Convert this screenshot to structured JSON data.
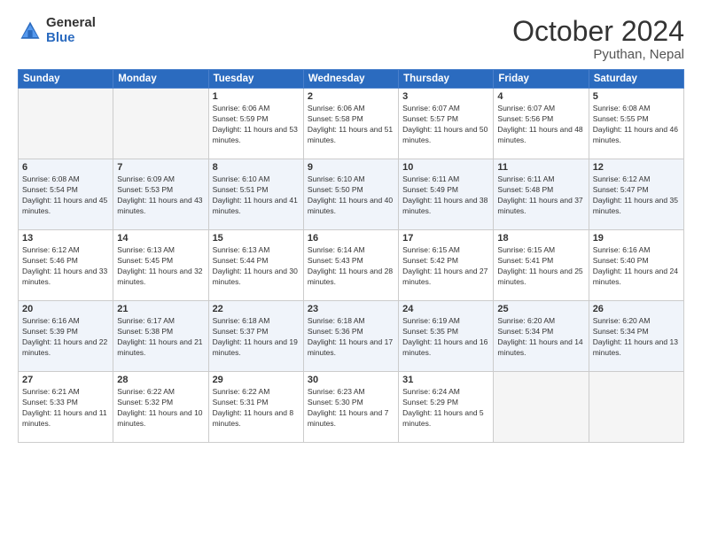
{
  "logo": {
    "general": "General",
    "blue": "Blue"
  },
  "header": {
    "month": "October 2024",
    "location": "Pyuthan, Nepal"
  },
  "weekdays": [
    "Sunday",
    "Monday",
    "Tuesday",
    "Wednesday",
    "Thursday",
    "Friday",
    "Saturday"
  ],
  "weeks": [
    [
      {
        "day": "",
        "empty": true
      },
      {
        "day": "",
        "empty": true
      },
      {
        "day": "1",
        "sunrise": "Sunrise: 6:06 AM",
        "sunset": "Sunset: 5:59 PM",
        "daylight": "Daylight: 11 hours and 53 minutes."
      },
      {
        "day": "2",
        "sunrise": "Sunrise: 6:06 AM",
        "sunset": "Sunset: 5:58 PM",
        "daylight": "Daylight: 11 hours and 51 minutes."
      },
      {
        "day": "3",
        "sunrise": "Sunrise: 6:07 AM",
        "sunset": "Sunset: 5:57 PM",
        "daylight": "Daylight: 11 hours and 50 minutes."
      },
      {
        "day": "4",
        "sunrise": "Sunrise: 6:07 AM",
        "sunset": "Sunset: 5:56 PM",
        "daylight": "Daylight: 11 hours and 48 minutes."
      },
      {
        "day": "5",
        "sunrise": "Sunrise: 6:08 AM",
        "sunset": "Sunset: 5:55 PM",
        "daylight": "Daylight: 11 hours and 46 minutes."
      }
    ],
    [
      {
        "day": "6",
        "sunrise": "Sunrise: 6:08 AM",
        "sunset": "Sunset: 5:54 PM",
        "daylight": "Daylight: 11 hours and 45 minutes."
      },
      {
        "day": "7",
        "sunrise": "Sunrise: 6:09 AM",
        "sunset": "Sunset: 5:53 PM",
        "daylight": "Daylight: 11 hours and 43 minutes."
      },
      {
        "day": "8",
        "sunrise": "Sunrise: 6:10 AM",
        "sunset": "Sunset: 5:51 PM",
        "daylight": "Daylight: 11 hours and 41 minutes."
      },
      {
        "day": "9",
        "sunrise": "Sunrise: 6:10 AM",
        "sunset": "Sunset: 5:50 PM",
        "daylight": "Daylight: 11 hours and 40 minutes."
      },
      {
        "day": "10",
        "sunrise": "Sunrise: 6:11 AM",
        "sunset": "Sunset: 5:49 PM",
        "daylight": "Daylight: 11 hours and 38 minutes."
      },
      {
        "day": "11",
        "sunrise": "Sunrise: 6:11 AM",
        "sunset": "Sunset: 5:48 PM",
        "daylight": "Daylight: 11 hours and 37 minutes."
      },
      {
        "day": "12",
        "sunrise": "Sunrise: 6:12 AM",
        "sunset": "Sunset: 5:47 PM",
        "daylight": "Daylight: 11 hours and 35 minutes."
      }
    ],
    [
      {
        "day": "13",
        "sunrise": "Sunrise: 6:12 AM",
        "sunset": "Sunset: 5:46 PM",
        "daylight": "Daylight: 11 hours and 33 minutes."
      },
      {
        "day": "14",
        "sunrise": "Sunrise: 6:13 AM",
        "sunset": "Sunset: 5:45 PM",
        "daylight": "Daylight: 11 hours and 32 minutes."
      },
      {
        "day": "15",
        "sunrise": "Sunrise: 6:13 AM",
        "sunset": "Sunset: 5:44 PM",
        "daylight": "Daylight: 11 hours and 30 minutes."
      },
      {
        "day": "16",
        "sunrise": "Sunrise: 6:14 AM",
        "sunset": "Sunset: 5:43 PM",
        "daylight": "Daylight: 11 hours and 28 minutes."
      },
      {
        "day": "17",
        "sunrise": "Sunrise: 6:15 AM",
        "sunset": "Sunset: 5:42 PM",
        "daylight": "Daylight: 11 hours and 27 minutes."
      },
      {
        "day": "18",
        "sunrise": "Sunrise: 6:15 AM",
        "sunset": "Sunset: 5:41 PM",
        "daylight": "Daylight: 11 hours and 25 minutes."
      },
      {
        "day": "19",
        "sunrise": "Sunrise: 6:16 AM",
        "sunset": "Sunset: 5:40 PM",
        "daylight": "Daylight: 11 hours and 24 minutes."
      }
    ],
    [
      {
        "day": "20",
        "sunrise": "Sunrise: 6:16 AM",
        "sunset": "Sunset: 5:39 PM",
        "daylight": "Daylight: 11 hours and 22 minutes."
      },
      {
        "day": "21",
        "sunrise": "Sunrise: 6:17 AM",
        "sunset": "Sunset: 5:38 PM",
        "daylight": "Daylight: 11 hours and 21 minutes."
      },
      {
        "day": "22",
        "sunrise": "Sunrise: 6:18 AM",
        "sunset": "Sunset: 5:37 PM",
        "daylight": "Daylight: 11 hours and 19 minutes."
      },
      {
        "day": "23",
        "sunrise": "Sunrise: 6:18 AM",
        "sunset": "Sunset: 5:36 PM",
        "daylight": "Daylight: 11 hours and 17 minutes."
      },
      {
        "day": "24",
        "sunrise": "Sunrise: 6:19 AM",
        "sunset": "Sunset: 5:35 PM",
        "daylight": "Daylight: 11 hours and 16 minutes."
      },
      {
        "day": "25",
        "sunrise": "Sunrise: 6:20 AM",
        "sunset": "Sunset: 5:34 PM",
        "daylight": "Daylight: 11 hours and 14 minutes."
      },
      {
        "day": "26",
        "sunrise": "Sunrise: 6:20 AM",
        "sunset": "Sunset: 5:34 PM",
        "daylight": "Daylight: 11 hours and 13 minutes."
      }
    ],
    [
      {
        "day": "27",
        "sunrise": "Sunrise: 6:21 AM",
        "sunset": "Sunset: 5:33 PM",
        "daylight": "Daylight: 11 hours and 11 minutes."
      },
      {
        "day": "28",
        "sunrise": "Sunrise: 6:22 AM",
        "sunset": "Sunset: 5:32 PM",
        "daylight": "Daylight: 11 hours and 10 minutes."
      },
      {
        "day": "29",
        "sunrise": "Sunrise: 6:22 AM",
        "sunset": "Sunset: 5:31 PM",
        "daylight": "Daylight: 11 hours and 8 minutes."
      },
      {
        "day": "30",
        "sunrise": "Sunrise: 6:23 AM",
        "sunset": "Sunset: 5:30 PM",
        "daylight": "Daylight: 11 hours and 7 minutes."
      },
      {
        "day": "31",
        "sunrise": "Sunrise: 6:24 AM",
        "sunset": "Sunset: 5:29 PM",
        "daylight": "Daylight: 11 hours and 5 minutes."
      },
      {
        "day": "",
        "empty": true
      },
      {
        "day": "",
        "empty": true
      }
    ]
  ]
}
